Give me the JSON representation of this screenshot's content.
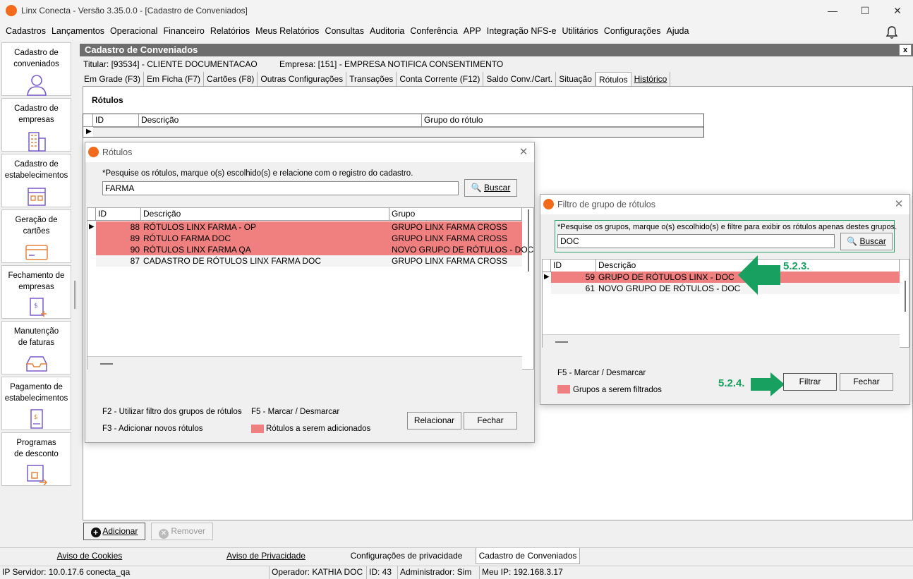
{
  "window": {
    "title": "Linx Conecta - Versão 3.35.0.0 - [Cadastro de Conveniados]",
    "minimize": "—",
    "maximize": "☐",
    "close": "✕"
  },
  "menu": [
    "Cadastros",
    "Lançamentos",
    "Operacional",
    "Financeiro",
    "Relatórios",
    "Meus Relatórios",
    "Consultas",
    "Auditoria",
    "Conferência",
    "APP",
    "Integração NFS-e",
    "Utilitários",
    "Configurações",
    "Ajuda"
  ],
  "sidebar": [
    {
      "label": "Cadastro de conveniados",
      "icon": "user-icon"
    },
    {
      "label": "Cadastro de empresas",
      "icon": "building-icon"
    },
    {
      "label": "Cadastro de estabelecimentos",
      "icon": "store-icon"
    },
    {
      "label": "Geração de cartões",
      "icon": "card-icon"
    },
    {
      "label": "Fechamento de empresas",
      "icon": "invoice-icon"
    },
    {
      "label": "Manutenção de faturas",
      "icon": "tray-icon"
    },
    {
      "label": "Pagamento de estabelecimentos",
      "icon": "payment-icon"
    },
    {
      "label": "Programas de desconto",
      "icon": "discount-icon"
    }
  ],
  "main": {
    "header": "Cadastro de Conveniados",
    "close": "x",
    "titular": "Titular: [93534] - CLIENTE DOCUMENTACAO",
    "empresa": "Empresa: [151] - EMPRESA NOTIFICA CONSENTIMENTO",
    "tabs": [
      "Em Grade (F3)",
      "Em Ficha (F7)",
      "Cartões (F8)",
      "Outras Configurações",
      "Transações",
      "Conta Corrente (F12)",
      "Saldo Conv./Cart.",
      "Situação",
      "Rótulos",
      "Histórico"
    ],
    "active_tab": "Rótulos",
    "section_title": "Rótulos",
    "grid_columns": [
      "ID",
      "Descrição",
      "Grupo do rótulo"
    ],
    "add_button": "Adicionar",
    "remove_button": "Remover"
  },
  "rotulos_dialog": {
    "title": "Rótulos",
    "instruction": "*Pesquise os rótulos, marque o(s) escolhido(s) e relacione com o registro do cadastro.",
    "search_value": "FARMA",
    "search_button": "Buscar",
    "columns": [
      "ID",
      "Descrição",
      "Grupo"
    ],
    "rows": [
      {
        "id": "88",
        "descricao": "RÓTULOS LINX FARMA - OP",
        "grupo": "GRUPO LINX  FARMA CROSS",
        "selected": true
      },
      {
        "id": "89",
        "descricao": "RÓTULO FARMA DOC",
        "grupo": "GRUPO LINX  FARMA CROSS",
        "selected": true
      },
      {
        "id": "90",
        "descricao": "RÓTULOS LINX FARMA QA",
        "grupo": "NOVO GRUPO DE RÓTULOS - DOC",
        "selected": true
      },
      {
        "id": "87",
        "descricao": "CADASTRO DE RÓTULOS LINX FARMA DOC",
        "grupo": "GRUPO LINX  FARMA CROSS",
        "selected": false
      }
    ],
    "hint_f2": "F2 - Utilizar filtro dos grupos de rótulos",
    "hint_sep": "-",
    "hint_f5": "F5 - Marcar / Desmarcar",
    "hint_f3": "F3 - Adicionar novos rótulos",
    "legend": "Rótulos a serem adicionados",
    "relacionar_button": "Relacionar",
    "fechar_button": "Fechar"
  },
  "filtro_dialog": {
    "title": "Filtro de grupo de rótulos",
    "instruction": "*Pesquise os grupos, marque o(s) escolhido(s) e filtre para exibir os rótulos apenas destes grupos.",
    "search_value": "DOC",
    "search_button": "Buscar",
    "columns": [
      "ID",
      "Descrição"
    ],
    "rows": [
      {
        "id": "59",
        "descricao": "GRUPO DE RÓTULOS LINX - DOC",
        "selected": true
      },
      {
        "id": "61",
        "descricao": "NOVO GRUPO DE RÓTULOS - DOC",
        "selected": false
      }
    ],
    "hint_f5": "F5 - Marcar / Desmarcar",
    "legend": "Grupos a serem filtrados",
    "filtrar_button": "Filtrar",
    "fechar_button": "Fechar",
    "annotation_1": "5.2.3.",
    "annotation_2": "5.2.4."
  },
  "status_tabs": [
    "Aviso de Cookies",
    "Aviso de Privacidade",
    "Configurações de privacidade",
    "Cadastro de Conveniados"
  ],
  "status": {
    "server": "IP Servidor: 10.0.17.6 conecta_qa",
    "operator": "Operador: KATHIA DOC",
    "id": "ID: 43",
    "admin": "Administrador: Sim",
    "ip": "Meu IP: 192.168.3.17"
  },
  "colors": {
    "selected_row": "#f08080",
    "annotation_green": "#18a060",
    "accent": "#f26b1d"
  }
}
